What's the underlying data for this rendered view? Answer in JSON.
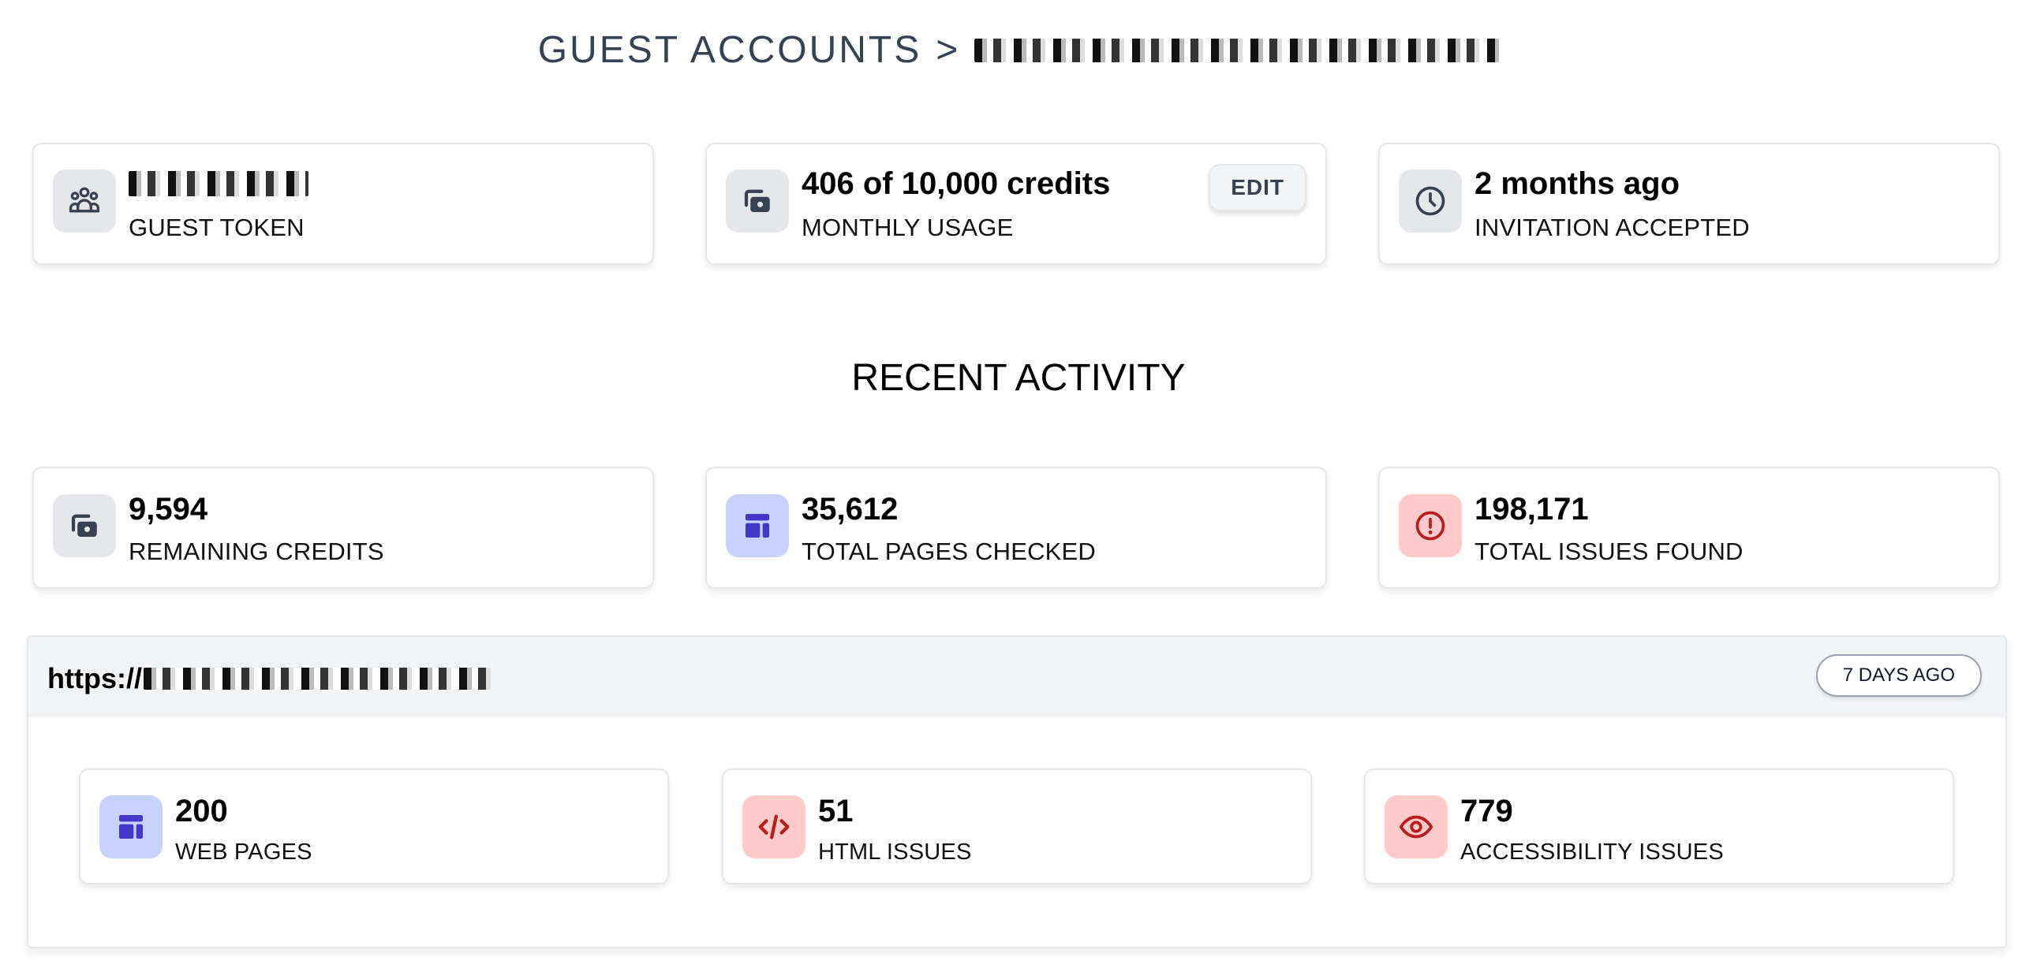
{
  "header": {
    "breadcrumb_root": "GUEST ACCOUNTS",
    "separator": ">",
    "account_name": "[redacted]"
  },
  "summary_cards": [
    {
      "icon": "users-icon",
      "value": "[redacted]",
      "label": "GUEST TOKEN"
    },
    {
      "icon": "credits-icon",
      "value": "406 of 10,000 credits",
      "label": "MONTHLY USAGE",
      "action_label": "EDIT"
    },
    {
      "icon": "clock-icon",
      "value": "2 months ago",
      "label": "INVITATION ACCEPTED"
    }
  ],
  "recent_activity": {
    "title": "RECENT ACTIVITY",
    "stats": [
      {
        "icon": "credits-icon",
        "value": "9,594",
        "label": "REMAINING CREDITS"
      },
      {
        "icon": "layout-icon",
        "value": "35,612",
        "label": "TOTAL PAGES CHECKED"
      },
      {
        "icon": "alert-circle-icon",
        "value": "198,171",
        "label": "TOTAL ISSUES FOUND"
      }
    ]
  },
  "site": {
    "url_prefix": "https://",
    "url_rest": "[redacted]",
    "checked": "7 DAYS AGO",
    "stats": [
      {
        "icon": "layout-icon",
        "value": "200",
        "label": "WEB PAGES"
      },
      {
        "icon": "code-icon",
        "value": "51",
        "label": "HTML ISSUES"
      },
      {
        "icon": "eye-icon",
        "value": "779",
        "label": "ACCESSIBILITY ISSUES"
      }
    ]
  },
  "colors": {
    "title": "#374151",
    "icon_gray": "#374151",
    "icon_indigo": "#4338ca",
    "icon_red": "#b91c1c",
    "tile_gray": "#e5e7eb",
    "tile_indigo": "#c7d2fe",
    "tile_red": "#fecaca",
    "panel_header": "#f3f4f6"
  }
}
